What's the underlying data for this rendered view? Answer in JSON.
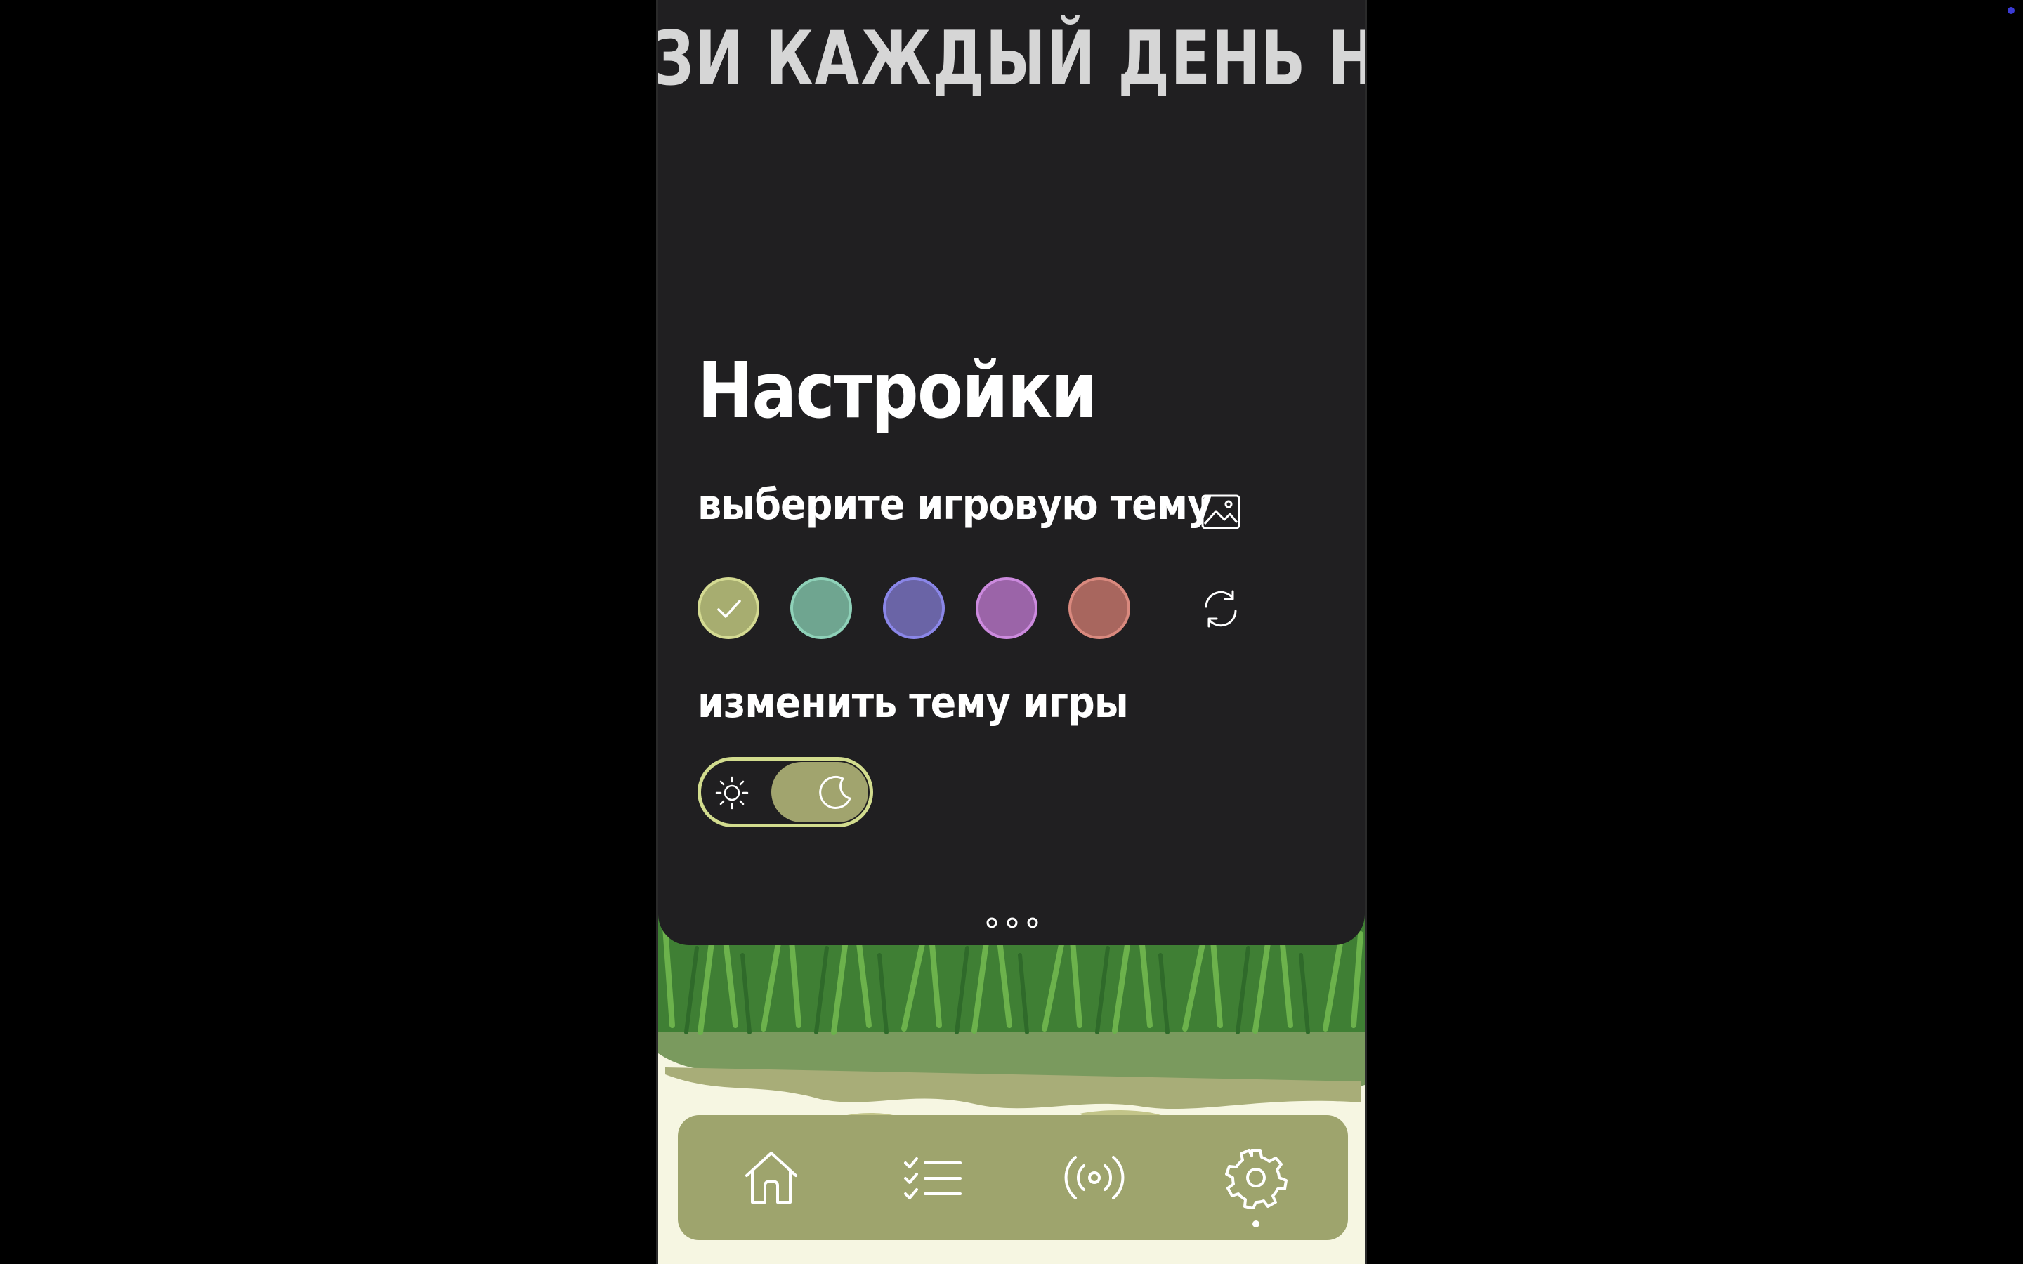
{
  "banner": {
    "marquee_text": "ЗИ КАЖДЫЙ ДЕНЬ НОВЫЕ С"
  },
  "settings": {
    "title": "Настройки",
    "theme_label": "выберите игровую тему",
    "mode_label": "изменить тему игры",
    "selected_swatch": 0,
    "swatches": [
      {
        "fill": "#a7ad70",
        "border": "#d4da92",
        "selected": true
      },
      {
        "fill": "#6fa590",
        "border": "#8ed1b8",
        "selected": false
      },
      {
        "fill": "#6a64a6",
        "border": "#8a86e8",
        "selected": false
      },
      {
        "fill": "#9b64a8",
        "border": "#cc8ade",
        "selected": false
      },
      {
        "fill": "#a8665e",
        "border": "#d9897e",
        "selected": false
      }
    ],
    "dark_mode_on": true
  },
  "icons": {
    "image": "image-icon",
    "refresh": "refresh-icon",
    "checkmark": "checkmark-icon",
    "sun": "sun-icon",
    "moon": "moon-icon",
    "nav": [
      "home-icon",
      "checklist-icon",
      "broadcast-icon",
      "gear-icon"
    ]
  },
  "nav": {
    "active_index": 3
  },
  "colors": {
    "panel_bg": "#201f21",
    "accent": "#9ea46d",
    "toggle_border": "#d2dc8e"
  }
}
